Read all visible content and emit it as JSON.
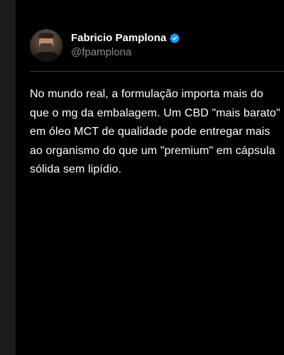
{
  "author": {
    "display_name": "Fabricio Pamplona",
    "handle": "@fpamplona",
    "verified": true,
    "avatar_icon": "profile-photo"
  },
  "post": {
    "text": "No mundo real, a formulação importa mais do que o mg da embalagem. Um CBD \"mais barato\" em óleo MCT de qualidade pode entregar mais ao organismo do que um \"premium\" em cápsula sólida sem lipídio."
  },
  "colors": {
    "background": "#1c1c1c",
    "card": "#000000",
    "text": "#ffffff",
    "handle": "#8b8b8b",
    "verified_badge": "#1d9bf0",
    "divider": "#3a3a3a"
  }
}
